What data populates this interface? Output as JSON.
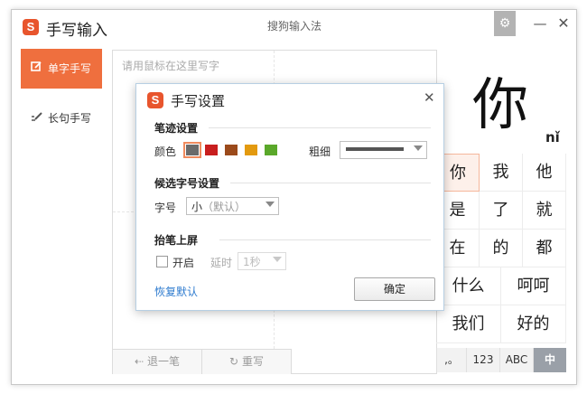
{
  "titlebar": {
    "logo": "S",
    "title": "手写输入",
    "brand": "搜狗输入法",
    "icons": {
      "settings": "gear-icon",
      "minimize": "minimize-icon",
      "close": "close-icon"
    }
  },
  "sidebar": {
    "items": [
      {
        "label": "单字手写",
        "icon": "pen-box-icon",
        "active": true
      },
      {
        "label": "长句手写",
        "icon": "pen-lines-icon",
        "active": false
      }
    ]
  },
  "canvas": {
    "hint": "请用鼠标在这里写字",
    "undo_label": "退一笔",
    "rewrite_label": "重写"
  },
  "result": {
    "character": "你",
    "pinyin": "nǐ",
    "candidates": [
      "你",
      "我",
      "他",
      "是",
      "了",
      "就",
      "在",
      "的",
      "都",
      "什么",
      "呵呵",
      "我们",
      "好的"
    ],
    "keys": [
      {
        "label": ",。",
        "active": false
      },
      {
        "label": "123",
        "active": false
      },
      {
        "label": "ABC",
        "active": false
      },
      {
        "label": "中",
        "active": true
      }
    ]
  },
  "dialog": {
    "logo": "S",
    "title": "手写设置",
    "stroke_section": "笔迹设置",
    "color_label": "颜色",
    "colors": [
      "#6b6b6b",
      "#c81e1e",
      "#9b4a1b",
      "#e39a0f",
      "#5aa82a"
    ],
    "selected_color_index": 0,
    "thickness_label": "粗细",
    "candidate_section": "候选字号设置",
    "font_size_label": "字号",
    "font_size_value": "小",
    "font_size_hint": "（默认）",
    "auto_commit_section": "抬笔上屏",
    "enable_label": "开启",
    "enable_checked": false,
    "delay_label": "延时",
    "delay_value": "1秒",
    "restore_label": "恢复默认",
    "ok_label": "确定"
  }
}
